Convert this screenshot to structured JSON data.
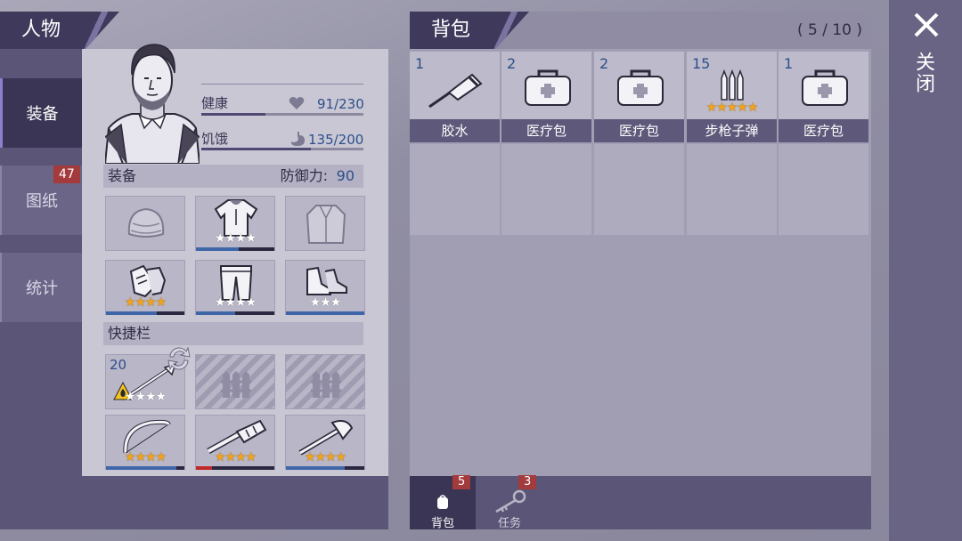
{
  "character": {
    "header": "人物",
    "tabs": [
      {
        "label": "装备",
        "active": true
      },
      {
        "label": "图纸",
        "badge": "47"
      },
      {
        "label": "统计"
      }
    ],
    "stats": [
      {
        "label": "健康",
        "value": "91/230",
        "icon": "heart-icon",
        "fraction": 0.396
      },
      {
        "label": "饥饿",
        "value": "135/200",
        "icon": "stomach-icon",
        "fraction": 0.675
      }
    ],
    "equipment": {
      "title": "装备",
      "defense_label": "防御力:",
      "defense_value": "90",
      "slots": [
        {
          "name": "hat",
          "icon": "hat-icon",
          "stars": 0,
          "max_stars": 0,
          "durability": 0
        },
        {
          "name": "shirt",
          "icon": "shirt-icon",
          "stars": 0,
          "max_stars": 4,
          "durability": 0.55
        },
        {
          "name": "jacket",
          "icon": "jacket-icon",
          "stars": 0,
          "max_stars": 0,
          "durability": 0
        },
        {
          "name": "gloves",
          "icon": "gloves-icon",
          "stars": 4,
          "max_stars": 4,
          "durability": 0.65
        },
        {
          "name": "pants",
          "icon": "pants-icon",
          "stars": 0,
          "max_stars": 4,
          "durability": 0.5
        },
        {
          "name": "boots",
          "icon": "boots-icon",
          "stars": 0,
          "max_stars": 3,
          "durability": 1.0
        }
      ]
    },
    "quickbar": {
      "title": "快捷栏",
      "slots": [
        {
          "name": "spear",
          "icon": "spear-icon",
          "count": "20",
          "stars": 0,
          "max_stars": 4,
          "swap": true,
          "fire": true,
          "locked": false
        },
        {
          "name": "locked-1",
          "icon": "locked-slot-icon",
          "locked": true
        },
        {
          "name": "locked-2",
          "icon": "locked-slot-icon",
          "locked": true
        },
        {
          "name": "bow",
          "icon": "bow-icon",
          "stars": 4,
          "max_stars": 4,
          "durability": 0.9,
          "locked": false
        },
        {
          "name": "club",
          "icon": "club-icon",
          "stars": 4,
          "max_stars": 4,
          "durability": 0.2,
          "bar_color": "#c0282a",
          "locked": false
        },
        {
          "name": "axe",
          "icon": "axe-icon",
          "stars": 4,
          "max_stars": 4,
          "durability": 0.75,
          "locked": false
        }
      ]
    }
  },
  "backpack": {
    "header": "背包",
    "capacity": "( 5 / 10 )",
    "items": [
      {
        "count": "1",
        "label": "胶水",
        "icon": "glue-tube-icon",
        "stars": 0
      },
      {
        "count": "2",
        "label": "医疗包",
        "icon": "medkit-icon",
        "stars": 0
      },
      {
        "count": "2",
        "label": "医疗包",
        "icon": "medkit-icon",
        "stars": 0
      },
      {
        "count": "15",
        "label": "步枪子弹",
        "icon": "rifle-ammo-icon",
        "stars": 5
      },
      {
        "count": "1",
        "label": "医疗包",
        "icon": "medkit-icon",
        "stars": 0
      }
    ],
    "footer_tabs": [
      {
        "label": "背包",
        "icon": "backpack-icon",
        "badge": "5",
        "active": true
      },
      {
        "label": "任务",
        "icon": "key-icon",
        "badge": "3",
        "active": false
      }
    ]
  },
  "close": {
    "label": "关闭",
    "icon": "close-icon"
  },
  "colors": {
    "accent": "#3f3a5c",
    "badge": "#a33a3c",
    "value_blue": "#2c4f8a",
    "star": "#f2a31a"
  }
}
